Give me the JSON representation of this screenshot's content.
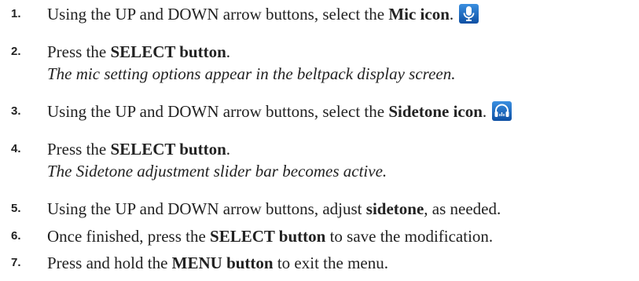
{
  "steps": [
    {
      "number": "1.",
      "parts": [
        "Using the UP and DOWN arrow buttons, select the ",
        "Mic icon",
        "."
      ],
      "icon": "mic-icon"
    },
    {
      "number": "2.",
      "parts": [
        "Press the ",
        "SELECT button",
        "."
      ],
      "sub": "The mic setting options appear in the beltpack display screen."
    },
    {
      "number": "3.",
      "parts": [
        "Using the UP and DOWN arrow buttons, select the ",
        "Sidetone icon",
        "."
      ],
      "icon": "headset-icon"
    },
    {
      "number": "4.",
      "parts": [
        "Press the ",
        "SELECT button",
        "."
      ],
      "sub": "The Sidetone adjustment slider bar becomes active."
    },
    {
      "number": "5.",
      "parts": [
        "Using the UP and DOWN arrow buttons, adjust ",
        "sidetone",
        ", as needed."
      ]
    },
    {
      "number": "6.",
      "parts": [
        "Once finished, press the ",
        "SELECT button",
        " to save the modification."
      ]
    },
    {
      "number": "7.",
      "parts": [
        "Press and hold the ",
        "MENU button",
        " to exit the menu."
      ]
    }
  ],
  "colors": {
    "icon_blue": "#1a66c2",
    "text": "#222222"
  }
}
